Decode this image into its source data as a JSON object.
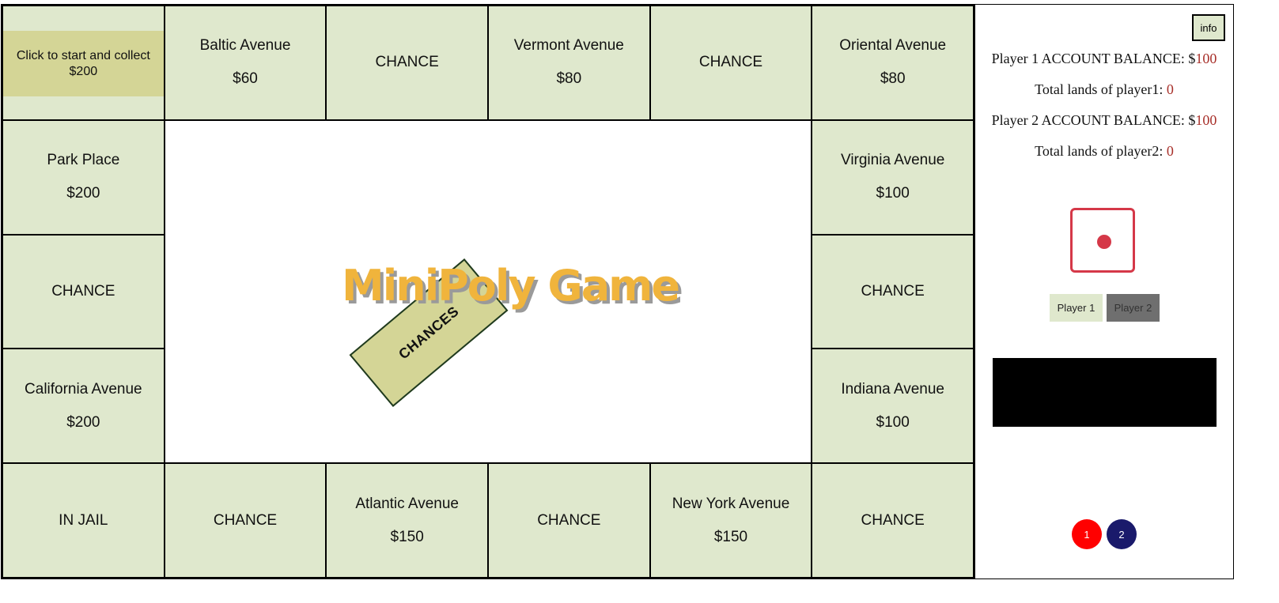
{
  "start": {
    "label": "Click to start and collect $200"
  },
  "spaces": {
    "top": [
      {
        "name": "Baltic Avenue",
        "price": "$60"
      },
      {
        "name": "CHANCE",
        "price": ""
      },
      {
        "name": "Vermont Avenue",
        "price": "$80"
      },
      {
        "name": "CHANCE",
        "price": ""
      },
      {
        "name": "Oriental Avenue",
        "price": "$80"
      }
    ],
    "left": [
      {
        "name": "Park Place",
        "price": "$200"
      },
      {
        "name": "CHANCE",
        "price": ""
      },
      {
        "name": "California Avenue",
        "price": "$200"
      }
    ],
    "right": [
      {
        "name": "Virginia Avenue",
        "price": "$100"
      },
      {
        "name": "CHANCE",
        "price": ""
      },
      {
        "name": "Indiana Avenue",
        "price": "$100"
      }
    ],
    "bottom": [
      {
        "name": "IN JAIL",
        "price": ""
      },
      {
        "name": "CHANCE",
        "price": ""
      },
      {
        "name": "Atlantic Avenue",
        "price": "$150"
      },
      {
        "name": "CHANCE",
        "price": ""
      },
      {
        "name": "New York Avenue",
        "price": "$150"
      },
      {
        "name": "CHANCE",
        "price": ""
      }
    ]
  },
  "center": {
    "chances_card": "CHANCES",
    "title": "MiniPoly Game"
  },
  "panel": {
    "info_button": "info",
    "player1_balance_label": "Player 1 ACCOUNT BALANCE: $",
    "player1_balance": "100",
    "player1_lands_label": "Total lands of player1: ",
    "player1_lands": "0",
    "player2_balance_label": "Player 2 ACCOUNT BALANCE: $",
    "player2_balance": "100",
    "player2_lands_label": "Total lands of player2: ",
    "player2_lands": "0",
    "dice_value": 1,
    "player1_button": "Player 1",
    "player2_button": "Player 2",
    "tokens": [
      "1",
      "2"
    ]
  },
  "colors": {
    "space": "#dfe8cd",
    "start": "#d4d596",
    "title": "#f0b43c",
    "dice": "#d53848",
    "token1": "#ff0000",
    "token2": "#1a1a6b"
  }
}
